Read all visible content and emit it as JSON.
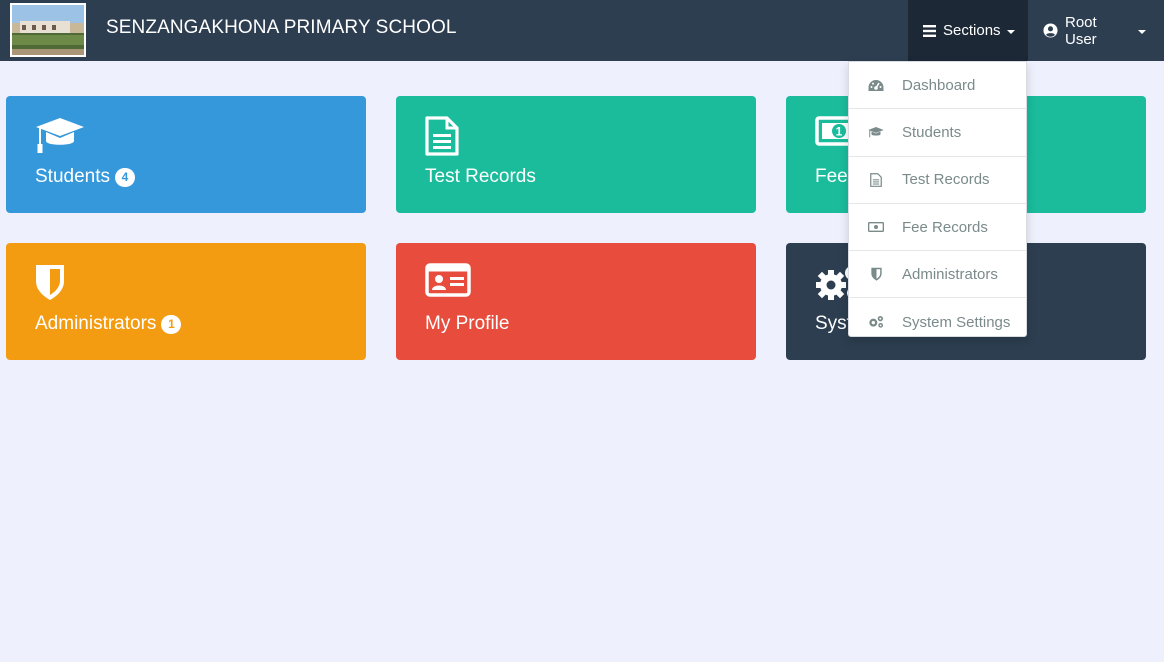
{
  "navbar": {
    "brand": "SENZANGAKHONA PRIMARY SCHOOL",
    "logo_alt": "school building photo",
    "sections_label": "Sections",
    "user_label": "Root User"
  },
  "tiles": [
    {
      "label": "Students",
      "badge": "4",
      "icon": "graduation-cap-icon",
      "color": "#3498db"
    },
    {
      "label": "Test Records",
      "badge": "",
      "icon": "document-icon",
      "color": "#1abc9c"
    },
    {
      "label": "Fee Records",
      "badge": "",
      "icon": "money-icon",
      "color": "#1abc9c"
    },
    {
      "label": "Administrators",
      "badge": "1",
      "icon": "shield-icon",
      "color": "#f39c12"
    },
    {
      "label": "My Profile",
      "badge": "",
      "icon": "id-card-icon",
      "color": "#e74c3c"
    },
    {
      "label": "System Settings",
      "badge": "",
      "icon": "gears-icon",
      "color": "#2c3e50"
    }
  ],
  "dropdown": {
    "items": [
      {
        "label": "Dashboard",
        "icon": "dashboard-icon"
      },
      {
        "label": "Students",
        "icon": "graduation-cap-icon"
      },
      {
        "label": "Test Records",
        "icon": "document-icon"
      },
      {
        "label": "Fee Records",
        "icon": "money-icon"
      },
      {
        "label": "Administrators",
        "icon": "shield-icon"
      },
      {
        "label": "System Settings",
        "icon": "gears-icon"
      }
    ]
  }
}
